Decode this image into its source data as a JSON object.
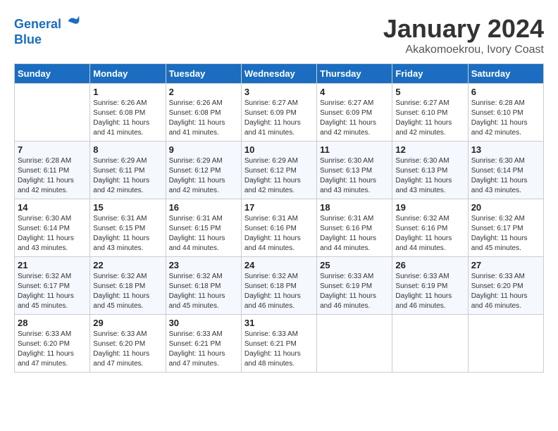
{
  "logo": {
    "line1": "General",
    "line2": "Blue"
  },
  "title": "January 2024",
  "subtitle": "Akakomoekrou, Ivory Coast",
  "weekdays": [
    "Sunday",
    "Monday",
    "Tuesday",
    "Wednesday",
    "Thursday",
    "Friday",
    "Saturday"
  ],
  "weeks": [
    [
      {
        "day": "",
        "sunrise": "",
        "sunset": "",
        "daylight": ""
      },
      {
        "day": "1",
        "sunrise": "Sunrise: 6:26 AM",
        "sunset": "Sunset: 6:08 PM",
        "daylight": "Daylight: 11 hours and 41 minutes."
      },
      {
        "day": "2",
        "sunrise": "Sunrise: 6:26 AM",
        "sunset": "Sunset: 6:08 PM",
        "daylight": "Daylight: 11 hours and 41 minutes."
      },
      {
        "day": "3",
        "sunrise": "Sunrise: 6:27 AM",
        "sunset": "Sunset: 6:09 PM",
        "daylight": "Daylight: 11 hours and 41 minutes."
      },
      {
        "day": "4",
        "sunrise": "Sunrise: 6:27 AM",
        "sunset": "Sunset: 6:09 PM",
        "daylight": "Daylight: 11 hours and 42 minutes."
      },
      {
        "day": "5",
        "sunrise": "Sunrise: 6:27 AM",
        "sunset": "Sunset: 6:10 PM",
        "daylight": "Daylight: 11 hours and 42 minutes."
      },
      {
        "day": "6",
        "sunrise": "Sunrise: 6:28 AM",
        "sunset": "Sunset: 6:10 PM",
        "daylight": "Daylight: 11 hours and 42 minutes."
      }
    ],
    [
      {
        "day": "7",
        "sunrise": "Sunrise: 6:28 AM",
        "sunset": "Sunset: 6:11 PM",
        "daylight": "Daylight: 11 hours and 42 minutes."
      },
      {
        "day": "8",
        "sunrise": "Sunrise: 6:29 AM",
        "sunset": "Sunset: 6:11 PM",
        "daylight": "Daylight: 11 hours and 42 minutes."
      },
      {
        "day": "9",
        "sunrise": "Sunrise: 6:29 AM",
        "sunset": "Sunset: 6:12 PM",
        "daylight": "Daylight: 11 hours and 42 minutes."
      },
      {
        "day": "10",
        "sunrise": "Sunrise: 6:29 AM",
        "sunset": "Sunset: 6:12 PM",
        "daylight": "Daylight: 11 hours and 42 minutes."
      },
      {
        "day": "11",
        "sunrise": "Sunrise: 6:30 AM",
        "sunset": "Sunset: 6:13 PM",
        "daylight": "Daylight: 11 hours and 43 minutes."
      },
      {
        "day": "12",
        "sunrise": "Sunrise: 6:30 AM",
        "sunset": "Sunset: 6:13 PM",
        "daylight": "Daylight: 11 hours and 43 minutes."
      },
      {
        "day": "13",
        "sunrise": "Sunrise: 6:30 AM",
        "sunset": "Sunset: 6:14 PM",
        "daylight": "Daylight: 11 hours and 43 minutes."
      }
    ],
    [
      {
        "day": "14",
        "sunrise": "Sunrise: 6:30 AM",
        "sunset": "Sunset: 6:14 PM",
        "daylight": "Daylight: 11 hours and 43 minutes."
      },
      {
        "day": "15",
        "sunrise": "Sunrise: 6:31 AM",
        "sunset": "Sunset: 6:15 PM",
        "daylight": "Daylight: 11 hours and 43 minutes."
      },
      {
        "day": "16",
        "sunrise": "Sunrise: 6:31 AM",
        "sunset": "Sunset: 6:15 PM",
        "daylight": "Daylight: 11 hours and 44 minutes."
      },
      {
        "day": "17",
        "sunrise": "Sunrise: 6:31 AM",
        "sunset": "Sunset: 6:16 PM",
        "daylight": "Daylight: 11 hours and 44 minutes."
      },
      {
        "day": "18",
        "sunrise": "Sunrise: 6:31 AM",
        "sunset": "Sunset: 6:16 PM",
        "daylight": "Daylight: 11 hours and 44 minutes."
      },
      {
        "day": "19",
        "sunrise": "Sunrise: 6:32 AM",
        "sunset": "Sunset: 6:16 PM",
        "daylight": "Daylight: 11 hours and 44 minutes."
      },
      {
        "day": "20",
        "sunrise": "Sunrise: 6:32 AM",
        "sunset": "Sunset: 6:17 PM",
        "daylight": "Daylight: 11 hours and 45 minutes."
      }
    ],
    [
      {
        "day": "21",
        "sunrise": "Sunrise: 6:32 AM",
        "sunset": "Sunset: 6:17 PM",
        "daylight": "Daylight: 11 hours and 45 minutes."
      },
      {
        "day": "22",
        "sunrise": "Sunrise: 6:32 AM",
        "sunset": "Sunset: 6:18 PM",
        "daylight": "Daylight: 11 hours and 45 minutes."
      },
      {
        "day": "23",
        "sunrise": "Sunrise: 6:32 AM",
        "sunset": "Sunset: 6:18 PM",
        "daylight": "Daylight: 11 hours and 45 minutes."
      },
      {
        "day": "24",
        "sunrise": "Sunrise: 6:32 AM",
        "sunset": "Sunset: 6:18 PM",
        "daylight": "Daylight: 11 hours and 46 minutes."
      },
      {
        "day": "25",
        "sunrise": "Sunrise: 6:33 AM",
        "sunset": "Sunset: 6:19 PM",
        "daylight": "Daylight: 11 hours and 46 minutes."
      },
      {
        "day": "26",
        "sunrise": "Sunrise: 6:33 AM",
        "sunset": "Sunset: 6:19 PM",
        "daylight": "Daylight: 11 hours and 46 minutes."
      },
      {
        "day": "27",
        "sunrise": "Sunrise: 6:33 AM",
        "sunset": "Sunset: 6:20 PM",
        "daylight": "Daylight: 11 hours and 46 minutes."
      }
    ],
    [
      {
        "day": "28",
        "sunrise": "Sunrise: 6:33 AM",
        "sunset": "Sunset: 6:20 PM",
        "daylight": "Daylight: 11 hours and 47 minutes."
      },
      {
        "day": "29",
        "sunrise": "Sunrise: 6:33 AM",
        "sunset": "Sunset: 6:20 PM",
        "daylight": "Daylight: 11 hours and 47 minutes."
      },
      {
        "day": "30",
        "sunrise": "Sunrise: 6:33 AM",
        "sunset": "Sunset: 6:21 PM",
        "daylight": "Daylight: 11 hours and 47 minutes."
      },
      {
        "day": "31",
        "sunrise": "Sunrise: 6:33 AM",
        "sunset": "Sunset: 6:21 PM",
        "daylight": "Daylight: 11 hours and 48 minutes."
      },
      {
        "day": "",
        "sunrise": "",
        "sunset": "",
        "daylight": ""
      },
      {
        "day": "",
        "sunrise": "",
        "sunset": "",
        "daylight": ""
      },
      {
        "day": "",
        "sunrise": "",
        "sunset": "",
        "daylight": ""
      }
    ]
  ]
}
